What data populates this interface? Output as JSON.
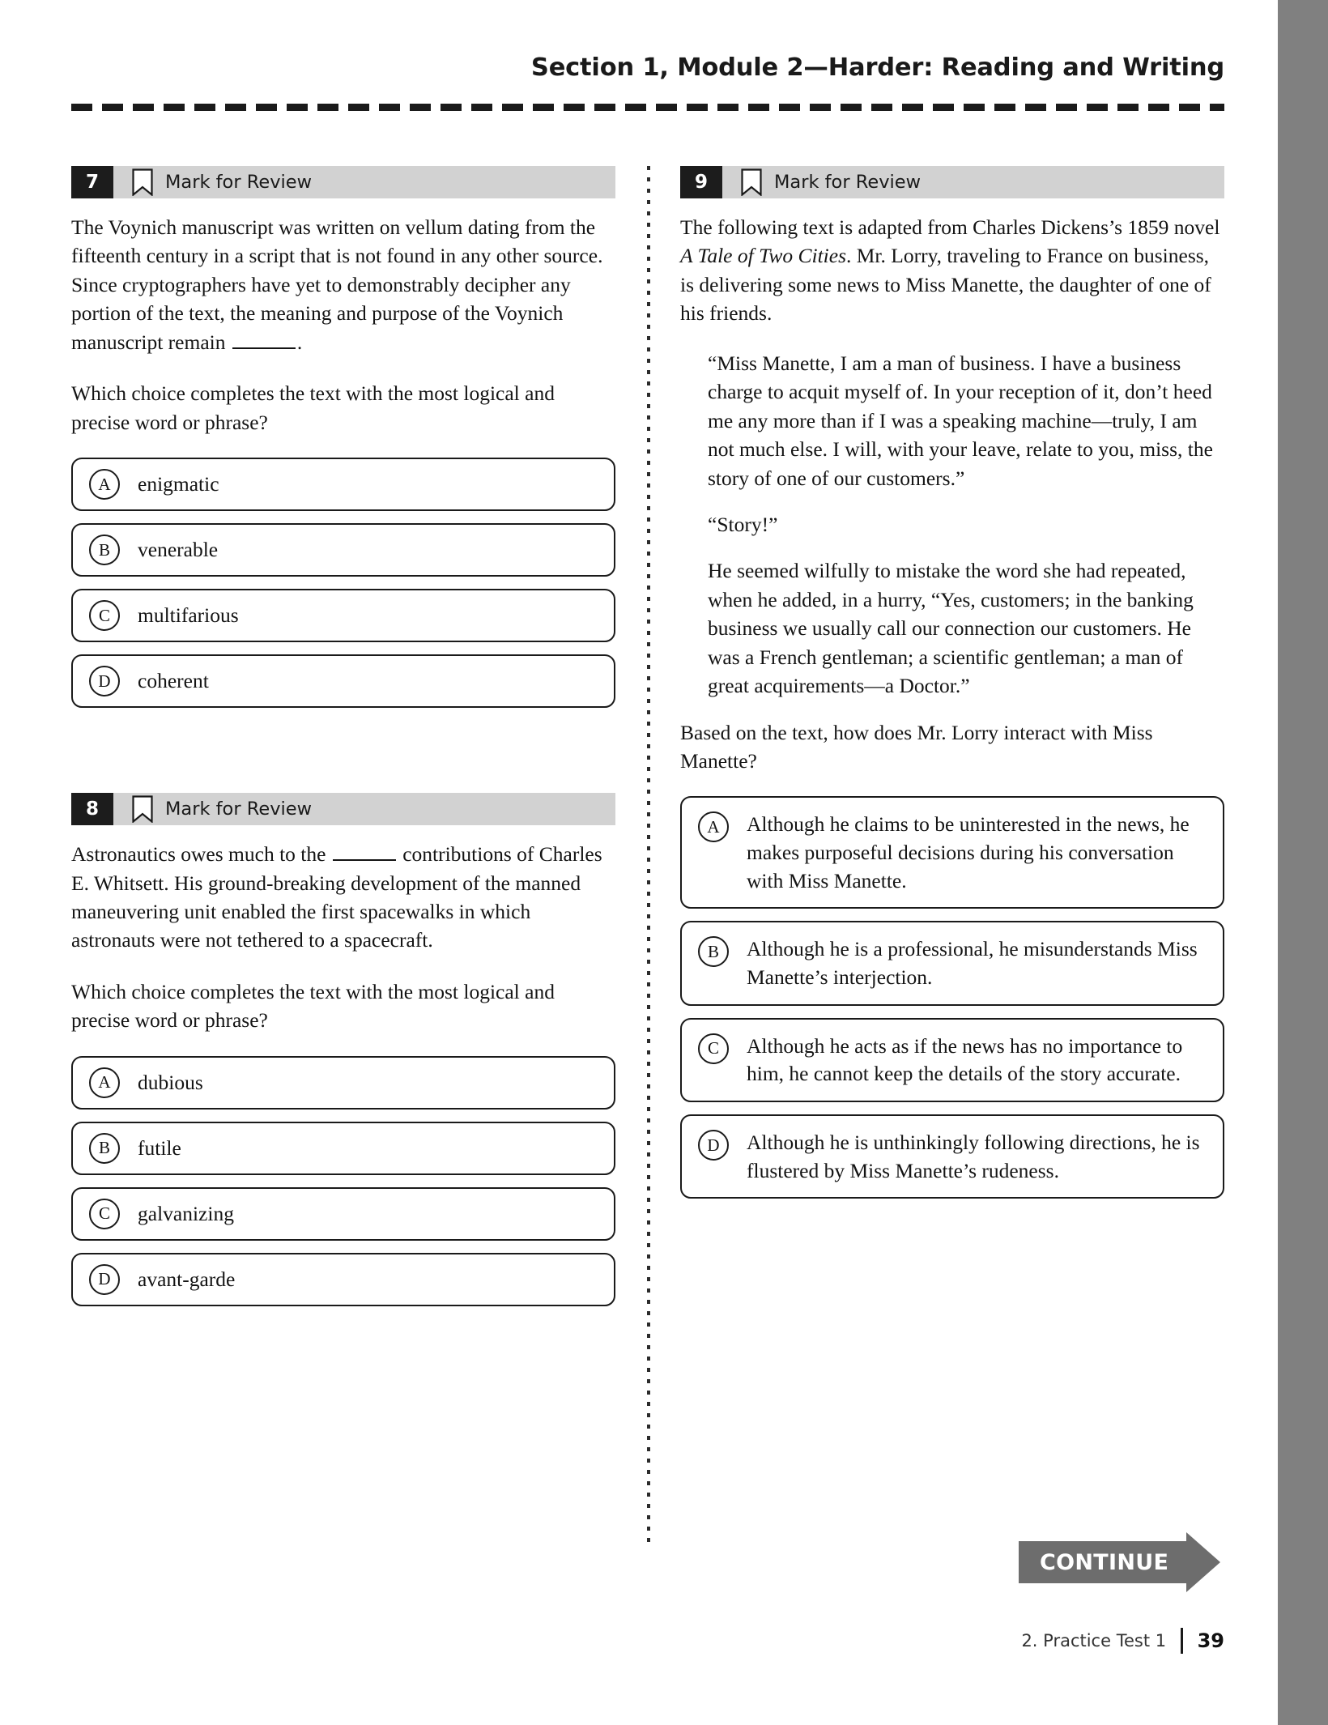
{
  "header": {
    "title": "Section 1, Module 2—Harder: Reading and Writing"
  },
  "mark_for_review_label": "Mark for Review",
  "questions": [
    {
      "number": "7",
      "column": "left",
      "body": "The Voynich manuscript was written on vellum dating from the fifteenth century in a script that is not found in any other source. Since cryptographers have yet to demonstrably decipher any portion of the text, the meaning and purpose of the Voynich manuscript remain ______.",
      "prompt": "Which choice completes the text with the most logical and precise word or phrase?",
      "choices": [
        {
          "letter": "A",
          "text": "enigmatic"
        },
        {
          "letter": "B",
          "text": "venerable"
        },
        {
          "letter": "C",
          "text": "multifarious"
        },
        {
          "letter": "D",
          "text": "coherent"
        }
      ]
    },
    {
      "number": "8",
      "column": "left",
      "body": "Astronautics owes much to the ______ contributions of Charles E. Whitsett. His ground-breaking development of the manned maneuvering unit enabled the first spacewalks in which astronauts were not tethered to a spacecraft.",
      "prompt": "Which choice completes the text with the most logical and precise word or phrase?",
      "choices": [
        {
          "letter": "A",
          "text": "dubious"
        },
        {
          "letter": "B",
          "text": "futile"
        },
        {
          "letter": "C",
          "text": "galvanizing"
        },
        {
          "letter": "D",
          "text": "avant-garde"
        }
      ]
    },
    {
      "number": "9",
      "column": "right",
      "intro_before_italic": "The following text is adapted from Charles Dickens’s 1859 novel ",
      "intro_italic": "A Tale of Two Cities",
      "intro_after_italic": ". Mr. Lorry, traveling to France on business, is delivering some news to Miss Manette, the daughter of one of his friends.",
      "passages": [
        "“Miss Manette, I am a man of business. I have a business charge to acquit myself of. In your reception of it, don’t heed me any more than if I was a speaking machine—truly, I am not much else. I will, with your leave, relate to you, miss, the story of one of our customers.”",
        "“Story!”",
        "He seemed wilfully to mistake the word she had repeated, when he added, in a hurry, “Yes, customers; in the banking business we usually call our connection our customers. He was a French gentleman; a scientific gentleman; a man of great acquirements—a Doctor.”"
      ],
      "prompt": "Based on the text, how does Mr. Lorry interact with Miss Manette?",
      "choices": [
        {
          "letter": "A",
          "text": "Although he claims to be uninterested in the news, he makes purposeful decisions during his conversation with Miss Manette."
        },
        {
          "letter": "B",
          "text": "Although he is a professional, he misunderstands Miss Manette’s interjection."
        },
        {
          "letter": "C",
          "text": "Although he acts as if the news has no importance to him, he cannot keep the details of the story accurate."
        },
        {
          "letter": "D",
          "text": "Although he is unthinkingly following directions, he is flustered by Miss Manette’s rudeness."
        }
      ]
    }
  ],
  "continue_button": {
    "label": "CONTINUE"
  },
  "footer": {
    "label": "2.  Practice Test 1",
    "page": "39"
  },
  "colors": {
    "question_header_bg": "#d2d2d2",
    "question_number_bg": "#1c1c1c",
    "continue_bg": "#6d6d6d",
    "edge_bar": "#808080"
  }
}
